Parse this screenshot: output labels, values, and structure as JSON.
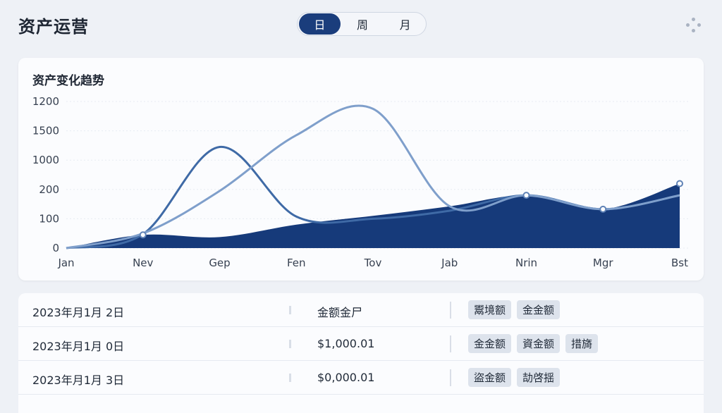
{
  "header": {
    "title": "资产运营",
    "segments": [
      {
        "label": "日",
        "active": true
      },
      {
        "label": "周",
        "active": false
      },
      {
        "label": "月",
        "active": false
      }
    ],
    "more_icon": "grid-dots-icon"
  },
  "chart_card": {
    "title": "资产变化趋势"
  },
  "chart_data": {
    "type": "area",
    "title": "资产变化趋势",
    "categories": [
      "Jan",
      "Nev",
      "Gep",
      "Fen",
      "Tov",
      "Jab",
      "Nrin",
      "Mgr",
      "Bst"
    ],
    "y_tick_labels": [
      "1200",
      "1500",
      "1000",
      "200",
      "100",
      "0"
    ],
    "series": [
      {
        "name": "",
        "style": "filled-area",
        "color": "#163a7a",
        "values": [
          0,
          90,
          75,
          160,
          220,
          285,
          360,
          265,
          440
        ]
      },
      {
        "name": "",
        "style": "line",
        "color": "#3f6aa6",
        "values": [
          0,
          95,
          690,
          215,
          200,
          255,
          360,
          265,
          360
        ]
      },
      {
        "name": "",
        "style": "line",
        "color": "#7f9fcb",
        "values": [
          0,
          100,
          390,
          770,
          950,
          285,
          360,
          265,
          360
        ]
      }
    ],
    "grid": true,
    "legend": "none"
  },
  "colors": {
    "accent": "#1a3d7c",
    "background": "#eef1f6",
    "card": "#fbfcfe"
  },
  "table": {
    "rows": [
      {
        "date": "2023年月1月 2日",
        "amount": "金额金尸",
        "tags": [
          "鬻境额",
          "金金额"
        ]
      },
      {
        "date": "2023年月1月 0日",
        "amount": "$1,000.01",
        "tags": [
          "金金额",
          "資金额",
          "措旖"
        ]
      },
      {
        "date": "2023年月1月 3日",
        "amount": "$0,000.01",
        "tags": [
          "盜金额",
          "劼啓揺"
        ]
      }
    ]
  }
}
